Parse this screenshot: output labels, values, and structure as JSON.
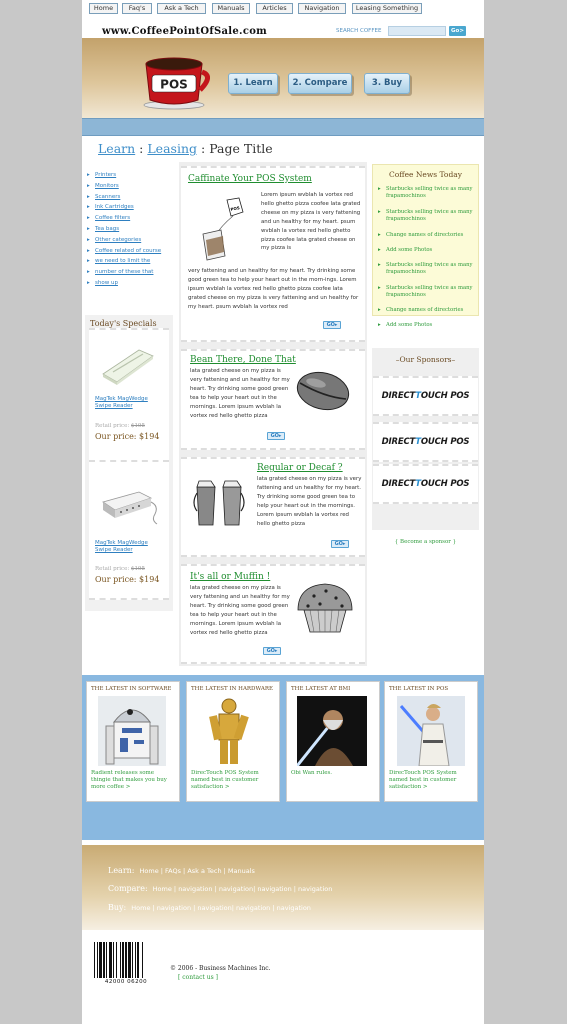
{
  "header": {
    "site": "www.CoffeePointOfSale.com",
    "search_label": "SEARCH COFFEE",
    "search_value": "",
    "go": "Go>"
  },
  "logo": {
    "text": "POS"
  },
  "top_buttons": [
    "1. Learn",
    "2. Compare",
    "3. Buy"
  ],
  "nav": [
    "Home",
    "Faq's",
    "Ask a Tech",
    "Manuals",
    "Articles",
    "Navigation",
    "Leasing Something"
  ],
  "breadcrumb": {
    "a": "Learn",
    "sep1": ":",
    "b": "Leasing",
    "sep2": ":",
    "current": "Page Title"
  },
  "sidebar_links": [
    "Printers",
    "Monitors",
    "Scanners",
    "Ink Cartridges",
    "Coffee filters",
    "Tea bags",
    "Other categories",
    "Coffee related of course",
    "we need to limit the",
    "number of these that",
    "show up"
  ],
  "specials": {
    "title": "Today's Specials",
    "items": [
      {
        "name": "MagTek MagWedge Swipe Reader",
        "retail_label": "Retail price:",
        "retail": "$195",
        "our_label": "Our price:",
        "price": "$194"
      },
      {
        "name": "MagTek MagWedge Swipe Reader",
        "retail_label": "Retail price:",
        "retail": "$195",
        "our_label": "Our price:",
        "price": "$194"
      }
    ]
  },
  "articles": [
    {
      "title": "Caffinate Your POS System",
      "body_top": "Lorem ipsum wvblah la vortex red hello ghetto pizza coofee lata grated cheese on my pizza is very fattening and un healthy for my heart. psum wvblah la vortex red hello ghetto pizza coofee lata grated cheese on my pizza is",
      "body_bottom": "very fattening and un healthy for my heart. Try drinking some good green tea to help your heart out in the morn-ings. Lorem ipsum wvblah la vortex red hello ghetto pizza coofee lata grated cheese on my pizza is very fattening and un healthy for my heart. psum wvblah la vortex red",
      "go": "GO"
    },
    {
      "title": "Bean There, Done That",
      "body": "lata grated cheese on my pizza is very fattening and un healthy for my heart. Try drinking some good green tea to help your heart out in the mornings. Lorem ipsum wvblah la vortex red hello ghetto pizza",
      "go": "GO"
    },
    {
      "title": "Regular or Decaf ?",
      "body": "lata grated cheese on my pizza is very fattening and un healthy for my heart. Try drinking some good green tea to help your heart out in the mornings. Lorem ipsum wvblah la vortex red hello ghetto pizza",
      "go": "GO"
    },
    {
      "title": "It's all or Muffin  !",
      "body": "lata grated cheese on my pizza is very fattening and un healthy for my heart. Try drinking some good green tea to help your heart out in the mornings. Lorem ipsum wvblah la vortex red hello ghetto pizza",
      "go": "GO"
    }
  ],
  "news": {
    "title": "Coffee News Today",
    "items": [
      "Starbucks selling twice as many frapamochinos",
      "Starbucks selling twice as many frapamochinos",
      "Change names of directories",
      "Add some Photos",
      "Starbucks selling twice as many frapamochinos",
      "Starbucks selling twice as many frapamochinos",
      "Change names of directories",
      "Add some Photos"
    ]
  },
  "sponsors": {
    "title": "–Our Sponsors–",
    "items": [
      {
        "a": "DIRECT",
        "b": "T",
        "c": "OUCH POS"
      },
      {
        "a": "DIRECT",
        "b": "T",
        "c": "OUCH POS"
      },
      {
        "a": "DIRECT",
        "b": "T",
        "c": "OUCH POS"
      }
    ],
    "become": "{ Become a sponsor }"
  },
  "latest": [
    {
      "head": "THE LATEST IN SOFTWARE",
      "text": "Radient releases some thingie that makes you buy more coffee >"
    },
    {
      "head": "THE LATEST IN HARDWARE",
      "text": "DirecTouch POS System named best in customer satisfaction >"
    },
    {
      "head": "THE LATEST AT BMI",
      "text": "Obi Wan rules."
    },
    {
      "head": "THE LATEST IN POS",
      "text": "DirecTouch POS System named best in customer satisfaction >"
    }
  ],
  "footer": {
    "learn_label": "Learn:",
    "learn_links": "Home | FAQs | Ask a Tech | Manuals",
    "compare_label": "Compare:",
    "compare_links": "Home | navigation | navigation| navigation | navigation",
    "buy_label": "Buy:",
    "buy_links": "Home | navigation | navigation| navigation | navigation",
    "barcode_number": "42000 06200",
    "copyright": "© 2006 - Business Machines Inc.",
    "contact": "[ contact us ]"
  },
  "colors": {
    "link_blue": "#2e7fc0",
    "green": "#2e9b3c",
    "brown": "#6a4a23",
    "nav_blue": "#8db6d6"
  }
}
